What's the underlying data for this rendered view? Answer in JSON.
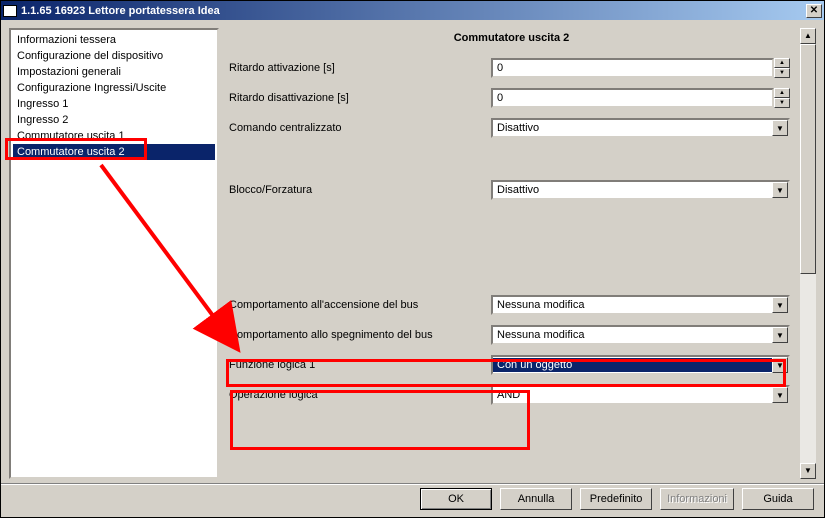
{
  "title": "1.1.65 16923 Lettore portatessera Idea",
  "sidebar": {
    "items": [
      {
        "label": "Informazioni tessera"
      },
      {
        "label": "Configurazione del dispositivo"
      },
      {
        "label": "Impostazioni generali"
      },
      {
        "label": "Configurazione Ingressi/Uscite"
      },
      {
        "label": "Ingresso 1"
      },
      {
        "label": "Ingresso 2"
      },
      {
        "label": "Commutatore uscita 1"
      },
      {
        "label": "Commutatore uscita 2"
      }
    ],
    "selected_index": 7
  },
  "main": {
    "title": "Commutatore uscita 2",
    "ritardo_attivazione": {
      "label": "Ritardo attivazione [s]",
      "value": "0"
    },
    "ritardo_disattivazione": {
      "label": "Ritardo disattivazione [s]",
      "value": "0"
    },
    "comando_centralizzato": {
      "label": "Comando centralizzato",
      "value": "Disattivo"
    },
    "blocco_forzatura": {
      "label": "Blocco/Forzatura",
      "value": "Disattivo"
    },
    "comportamento_accensione": {
      "label": "Comportamento all'accensione del bus",
      "value": "Nessuna modifica"
    },
    "comportamento_spegnimento": {
      "label": "Comportamento allo spegnimento del bus",
      "value": "Nessuna modifica"
    },
    "funzione_logica_1": {
      "label": "Funzione logica 1",
      "value": "Con un oggetto"
    },
    "operazione_logica": {
      "label": "Operazione logica",
      "value": "AND"
    }
  },
  "buttons": {
    "ok": "OK",
    "annulla": "Annulla",
    "predefinito": "Predefinito",
    "informazioni": "Informazioni",
    "guida": "Guida"
  }
}
